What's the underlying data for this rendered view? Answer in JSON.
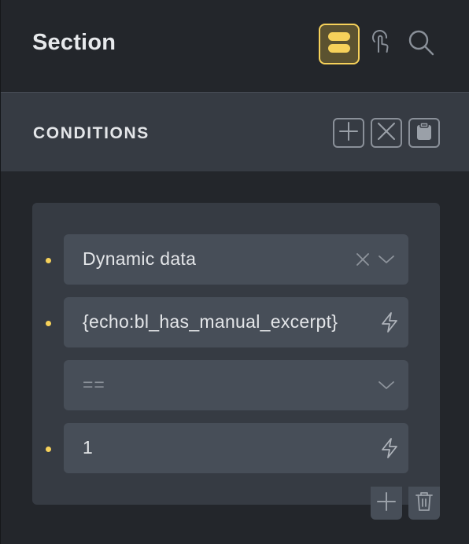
{
  "header": {
    "title": "Section",
    "icons": [
      "layout-icon",
      "pointer-icon",
      "search-icon"
    ],
    "accent_color": "#f6d15a"
  },
  "conditions": {
    "title": "CONDITIONS",
    "actions": [
      "add-icon",
      "close-icon",
      "clipboard-icon"
    ]
  },
  "condition": {
    "key": "Dynamic data",
    "value": "{echo:bl_has_manual_excerpt}",
    "operator_placeholder": "==",
    "compare": "1"
  }
}
